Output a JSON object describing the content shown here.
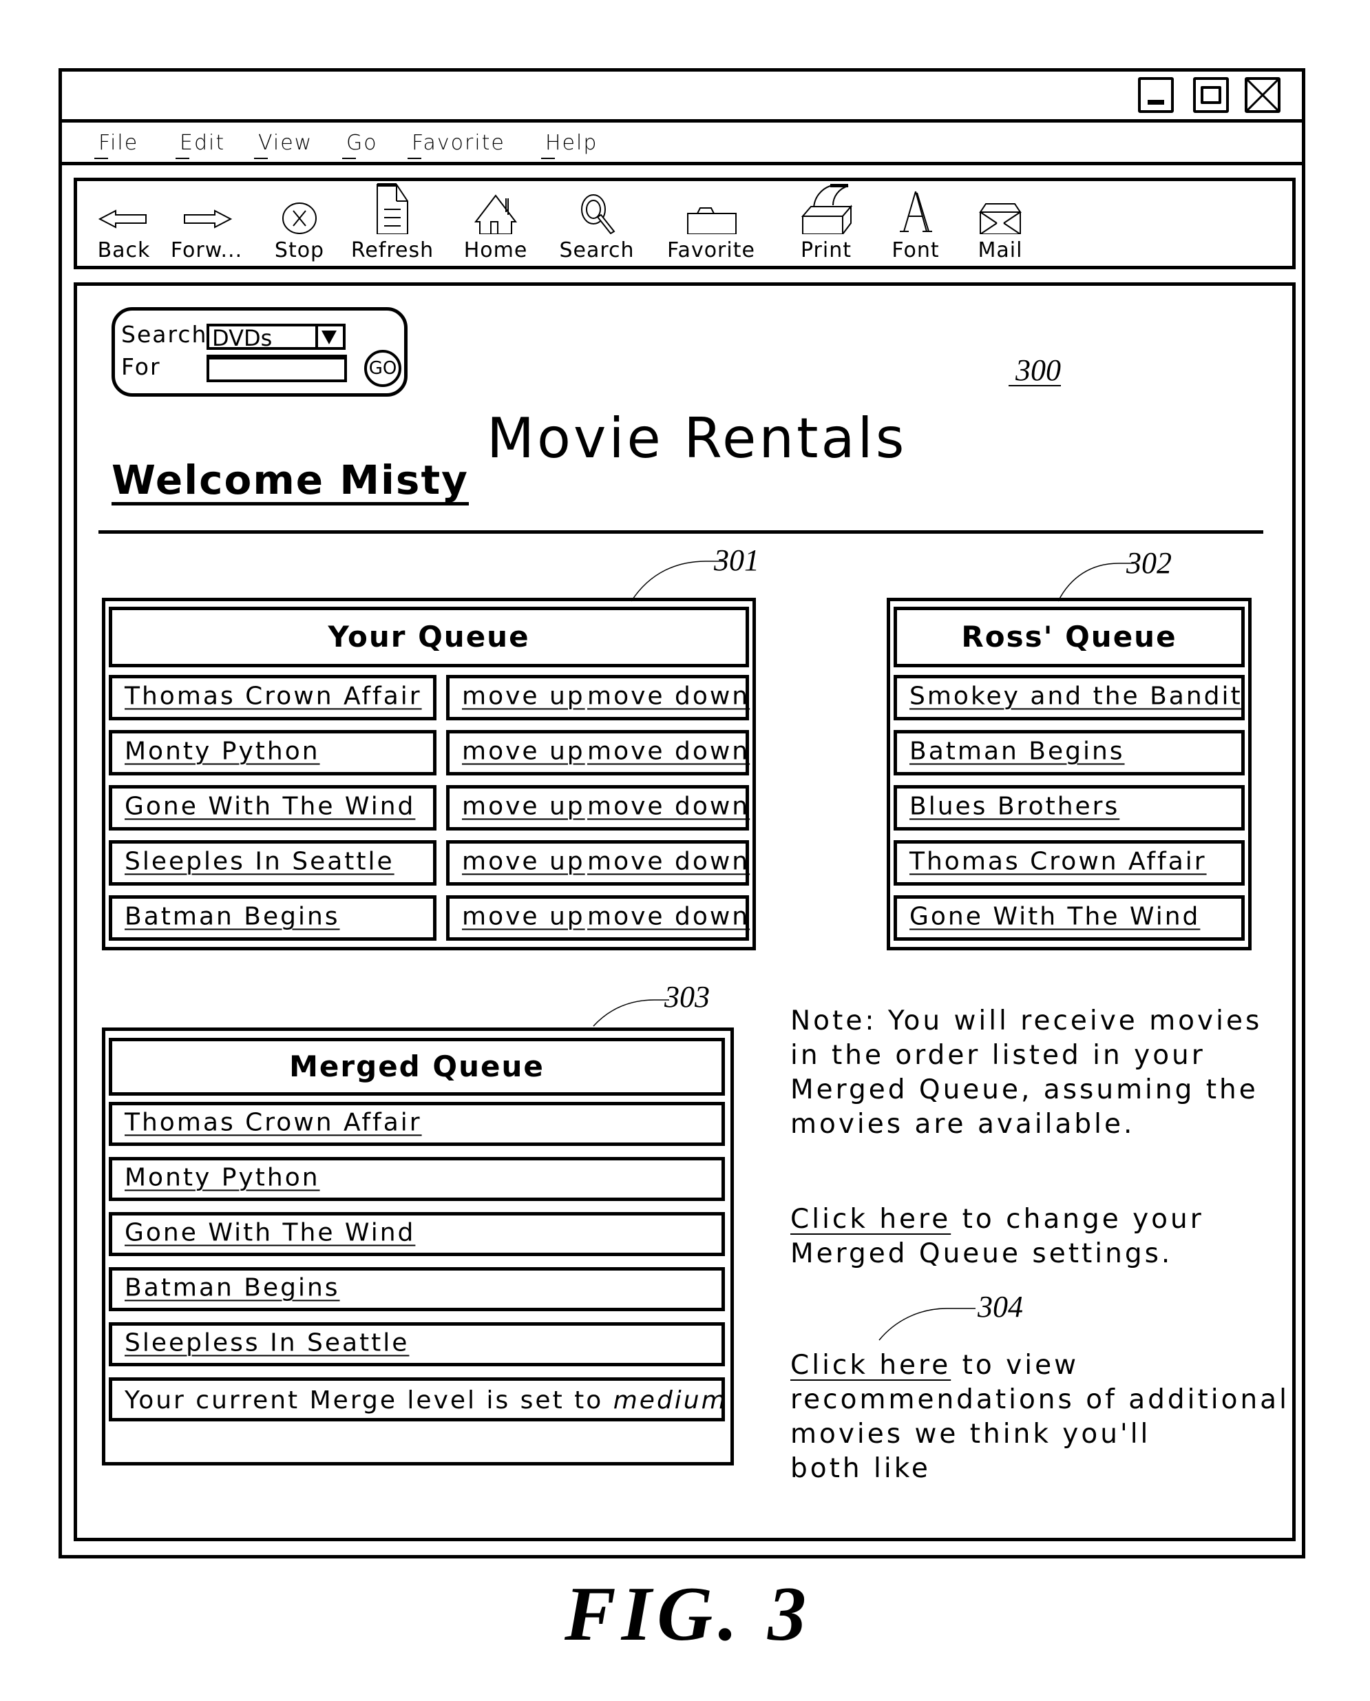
{
  "window": {
    "controls": [
      {
        "name": "minimize",
        "icon": "minimize-icon"
      },
      {
        "name": "maximize",
        "icon": "maximize-icon"
      },
      {
        "name": "close",
        "icon": "close-icon"
      }
    ]
  },
  "menu": [
    "File",
    "Edit",
    "View",
    "Go",
    "Favorite",
    "Help"
  ],
  "toolbar": [
    {
      "label": "Back",
      "icon": "back-arrow-icon"
    },
    {
      "label": "Forw...",
      "icon": "forward-arrow-icon"
    },
    {
      "label": "Stop",
      "icon": "stop-icon"
    },
    {
      "label": "Refresh",
      "icon": "refresh-document-icon"
    },
    {
      "label": "Home",
      "icon": "home-icon"
    },
    {
      "label": "Search",
      "icon": "magnifier-icon"
    },
    {
      "label": "Favorite",
      "icon": "folder-icon"
    },
    {
      "label": "Print",
      "icon": "printer-icon"
    },
    {
      "label": "Font",
      "icon": "font-icon"
    },
    {
      "label": "Mail",
      "icon": "envelope-icon"
    }
  ],
  "search": {
    "search_label": "Search",
    "for_label": "For",
    "category_selected": "DVDs",
    "query_value": "",
    "go_label": "GO"
  },
  "page": {
    "title": "Movie Rentals",
    "welcome": "Welcome Misty",
    "ref_numeral": "300"
  },
  "your_queue": {
    "ref_numeral": "301",
    "title": "Your Queue",
    "move_up_label": "move up",
    "move_down_label": "move down",
    "items": [
      "Thomas Crown Affair",
      "Monty Python",
      "Gone With The Wind",
      "Sleeples In Seattle",
      "Batman Begins"
    ]
  },
  "ross_queue": {
    "ref_numeral": "302",
    "title": "Ross' Queue",
    "items": [
      "Smokey and the Bandit",
      "Batman Begins",
      "Blues Brothers",
      "Thomas Crown Affair",
      "Gone With The Wind"
    ]
  },
  "merged_queue": {
    "ref_numeral": "303",
    "title": "Merged Queue",
    "items": [
      "Thomas Crown Affair",
      "Monty Python",
      "Gone With The Wind",
      "Batman Begins",
      "Sleepless In Seattle"
    ],
    "merge_level_prefix": "Your current Merge level is set to",
    "merge_level_value": "medium"
  },
  "notes": {
    "note_lines": [
      "Note: You will receive movies",
      "in the order listed in your",
      "Merged Queue, assuming the",
      "movies are available."
    ],
    "settings_link": "Click here",
    "settings_line1_rest": " to change your",
    "settings_line2": "Merged Queue settings.",
    "recs_ref_numeral": "304",
    "recs_link": "Click here",
    "recs_line1_rest": " to view",
    "recs_line2": "recommendations of additional",
    "recs_line3": "movies we think you'll",
    "recs_line4": "both like"
  },
  "figure_caption": "FIG. 3"
}
